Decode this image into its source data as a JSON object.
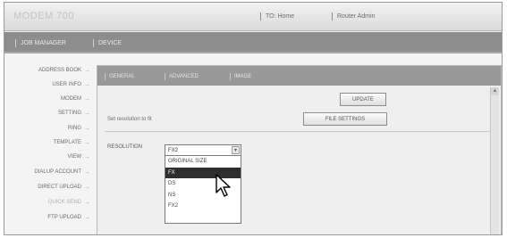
{
  "header": {
    "brand": "MODEM 700",
    "links": [
      "TO: Home",
      "Router Admin"
    ]
  },
  "nav": {
    "tabs": [
      "JOB MANAGER",
      "DEVICE"
    ]
  },
  "sidebar": {
    "items": [
      {
        "label": "ADDRESS BOOK"
      },
      {
        "label": "USER INFO"
      },
      {
        "label": "MODEM"
      },
      {
        "label": "SETTING"
      },
      {
        "label": "RING"
      },
      {
        "label": "TEMPLATE"
      },
      {
        "label": "VIEW"
      },
      {
        "label": "DIALUP ACCOUNT"
      },
      {
        "label": "DIRECT UPLOAD"
      },
      {
        "label": "QUICK SEND"
      },
      {
        "label": "FTP UPLOAD"
      }
    ],
    "active_index": 9
  },
  "main": {
    "subtabs": [
      "GENERAL",
      "ADVANCED",
      "IMAGE"
    ],
    "update_label": "UPDATE",
    "file_settings_label": "FILE SETTINGS",
    "description": "Set resolution to fit",
    "resolution": {
      "label": "RESOLUTION",
      "value": "FX2",
      "options": [
        "ORIGINAL SIZE",
        "FX",
        "DS",
        "NS",
        "FX2"
      ],
      "highlighted_index": 1
    }
  }
}
